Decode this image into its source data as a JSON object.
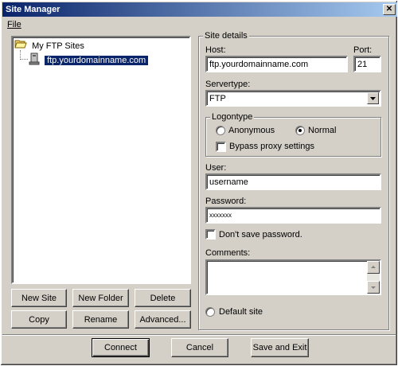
{
  "window": {
    "title": "Site Manager",
    "close_glyph": "✕"
  },
  "menu": {
    "file_label": "File"
  },
  "tree": {
    "root_label": "My FTP Sites",
    "child_label": "ftp.yourdomainname.com"
  },
  "buttons": {
    "new_site": "New Site",
    "new_folder": "New Folder",
    "delete": "Delete",
    "copy": "Copy",
    "rename": "Rename",
    "advanced": "Advanced...",
    "connect": "Connect",
    "cancel": "Cancel",
    "save_exit": "Save and Exit"
  },
  "details": {
    "group_label": "Site details",
    "host_label": "Host:",
    "host_value": "ftp.yourdomainname.com",
    "port_label": "Port:",
    "port_value": "21",
    "servertype_label": "Servertype:",
    "servertype_value": "FTP",
    "logontype_label": "Logontype",
    "anonymous_label": "Anonymous",
    "normal_label": "Normal",
    "logon_selected": "Normal",
    "bypass_label": "Bypass proxy settings",
    "bypass_checked": false,
    "user_label": "User:",
    "user_value": "username",
    "password_label": "Password:",
    "password_value": "xxxxxxx",
    "dont_save_label": "Don't save password.",
    "dont_save_checked": false,
    "comments_label": "Comments:",
    "comments_value": "",
    "default_site_label": "Default site",
    "default_site_checked": false
  },
  "colors": {
    "selection": "#0a246a",
    "face": "#d4d0c8"
  }
}
